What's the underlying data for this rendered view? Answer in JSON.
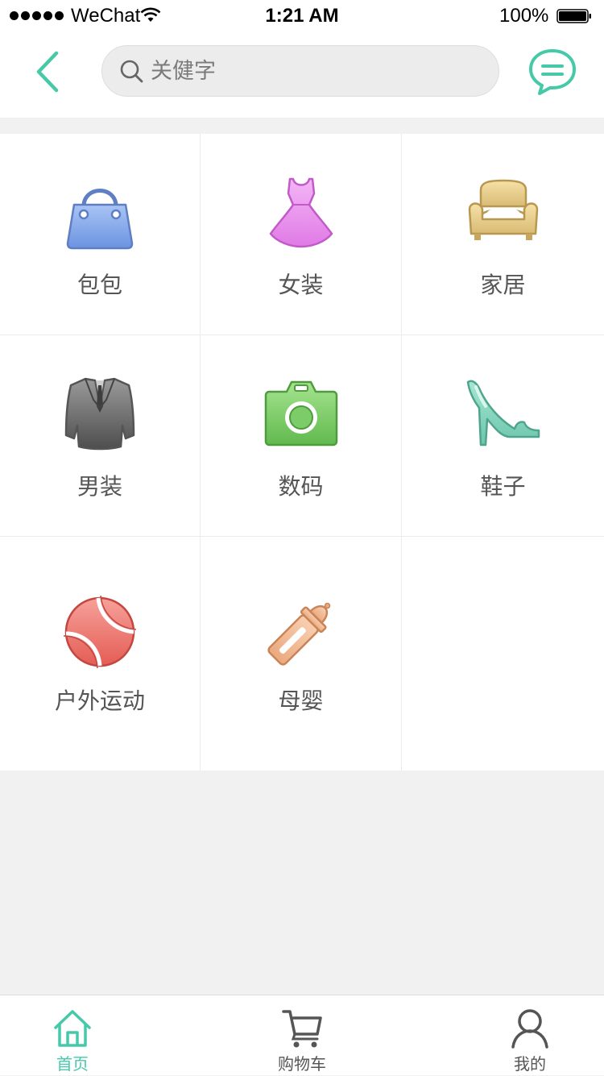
{
  "status_bar": {
    "carrier": "WeChat",
    "time": "1:21 AM",
    "battery": "100%"
  },
  "header": {
    "search_placeholder": "关健字",
    "back_icon": "chevron-left-icon",
    "chat_icon": "chat-bubble-icon",
    "accent_color": "#46c9a8"
  },
  "categories": [
    {
      "label": "包包",
      "icon": "handbag-icon",
      "color": "#7fa4e8"
    },
    {
      "label": "女装",
      "icon": "dress-icon",
      "color": "#e98ef0"
    },
    {
      "label": "家居",
      "icon": "armchair-icon",
      "color": "#e3c98a"
    },
    {
      "label": "男装",
      "icon": "suit-jacket-icon",
      "color": "#7a7a7a"
    },
    {
      "label": "数码",
      "icon": "camera-icon",
      "color": "#7ccd6a"
    },
    {
      "label": "鞋子",
      "icon": "high-heel-icon",
      "color": "#86d6c1"
    },
    {
      "label": "户外运动",
      "icon": "tennis-ball-icon",
      "color": "#ec7870"
    },
    {
      "label": "母婴",
      "icon": "baby-bottle-icon",
      "color": "#f1b892"
    }
  ],
  "tabbar": {
    "tabs": [
      {
        "label": "首页",
        "icon": "home-icon",
        "active": true
      },
      {
        "label": "购物车",
        "icon": "cart-icon",
        "active": false
      },
      {
        "label": "我的",
        "icon": "user-icon",
        "active": false
      }
    ]
  }
}
